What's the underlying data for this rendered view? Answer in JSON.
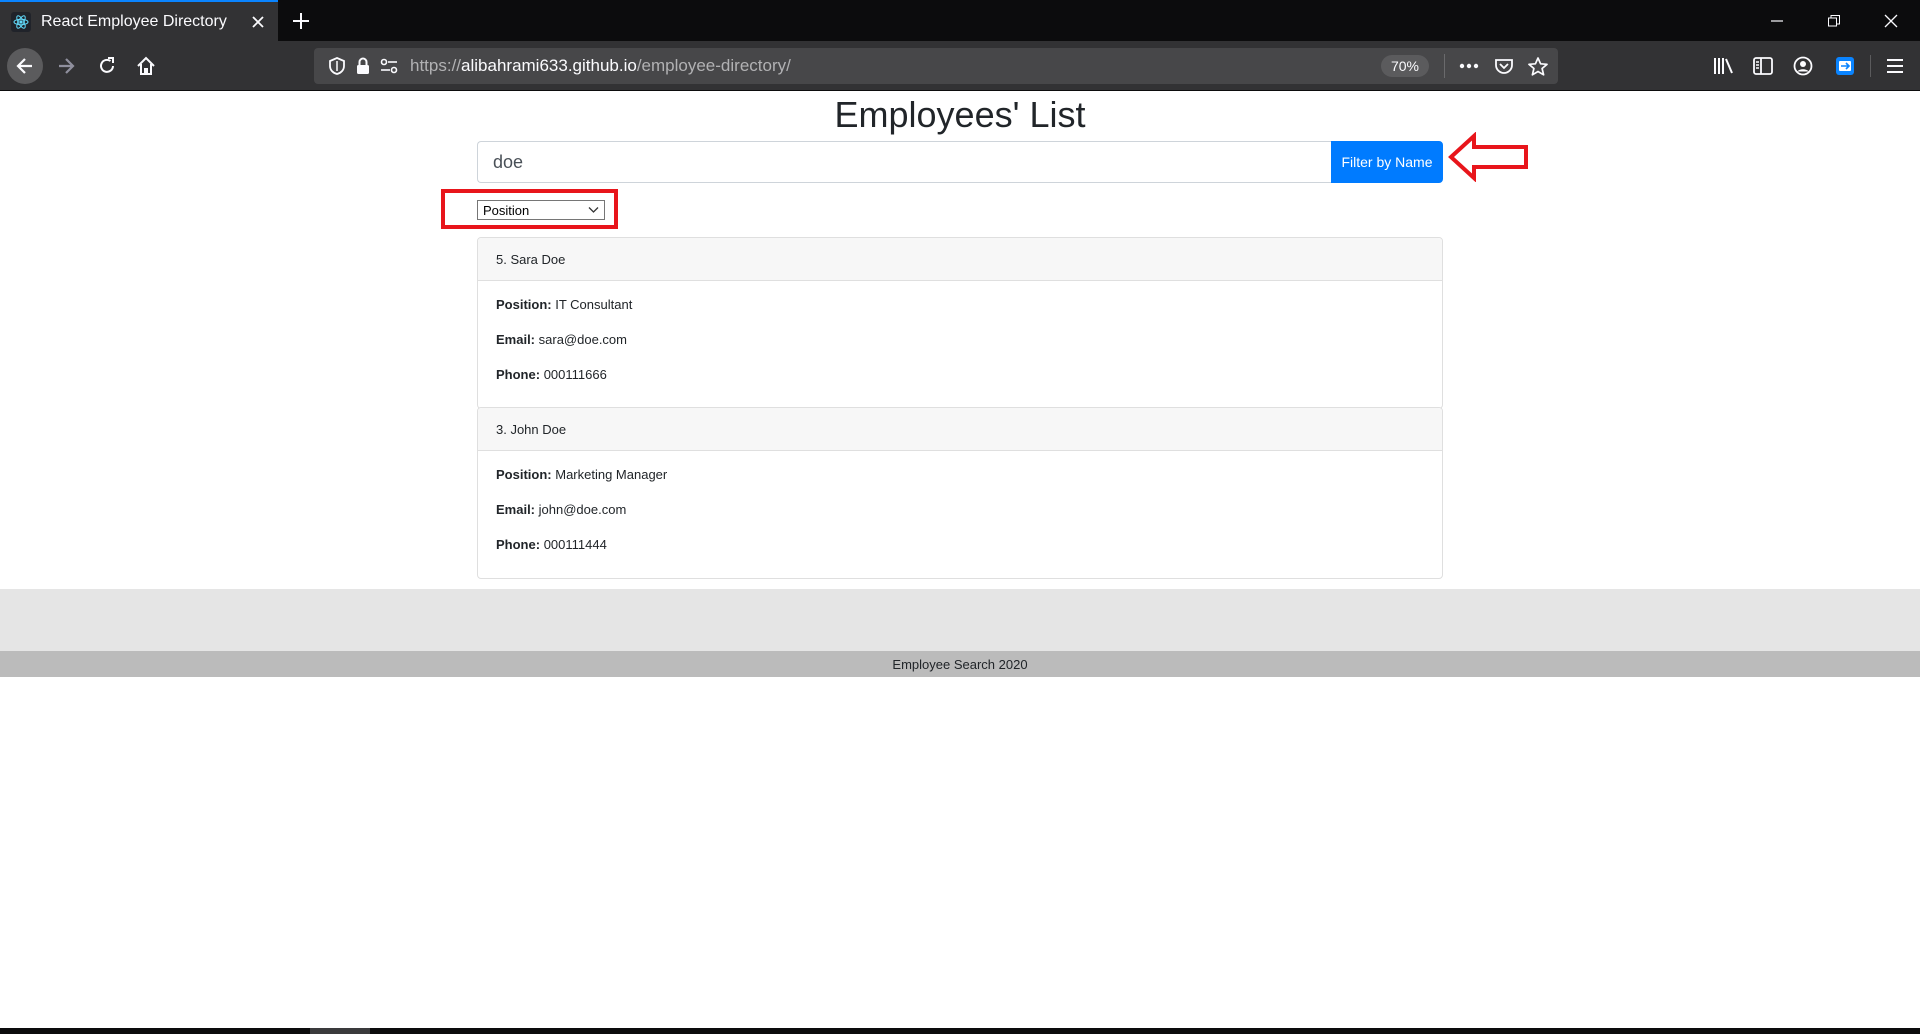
{
  "browser": {
    "tab_title": "React Employee Directory",
    "url_prefix": "https://",
    "url_host": "alibahrami633.github.io",
    "url_path": "/employee-directory/",
    "zoom": "70%",
    "icons": {
      "favicon": "react-logo-icon",
      "tab_close": "close-icon",
      "new_tab": "plus-icon",
      "minimize": "minimize-icon",
      "restore": "restore-icon",
      "close_window": "close-icon",
      "back": "arrow-left-icon",
      "forward": "arrow-right-icon",
      "reload": "reload-icon",
      "home": "home-icon",
      "tracking": "shield-icon",
      "lock": "lock-icon",
      "permissions": "permissions-icon",
      "page_actions": "ellipsis-icon",
      "pocket": "pocket-icon",
      "bookmark": "star-icon",
      "library": "library-icon",
      "sidebar": "sidebar-icon",
      "account": "account-icon",
      "extension": "extension-icon",
      "menu": "hamburger-icon"
    }
  },
  "page": {
    "title": "Employees' List",
    "search_value": "doe",
    "filter_button": "Filter by Name",
    "select_value": "Position",
    "employees": [
      {
        "header": "5. Sara Doe",
        "position_label": "Position:",
        "position": "IT Consultant",
        "email_label": "Email:",
        "email": "sara@doe.com",
        "phone_label": "Phone:",
        "phone": "000111666"
      },
      {
        "header": "3. John Doe",
        "position_label": "Position:",
        "position": "Marketing Manager",
        "email_label": "Email:",
        "email": "john@doe.com",
        "phone_label": "Phone:",
        "phone": "000111444"
      }
    ],
    "footer": "Employee Search 2020"
  },
  "colors": {
    "primary_button": "#007bff",
    "annotation_red": "#e8151b",
    "tab_accent": "#0a84ff"
  }
}
